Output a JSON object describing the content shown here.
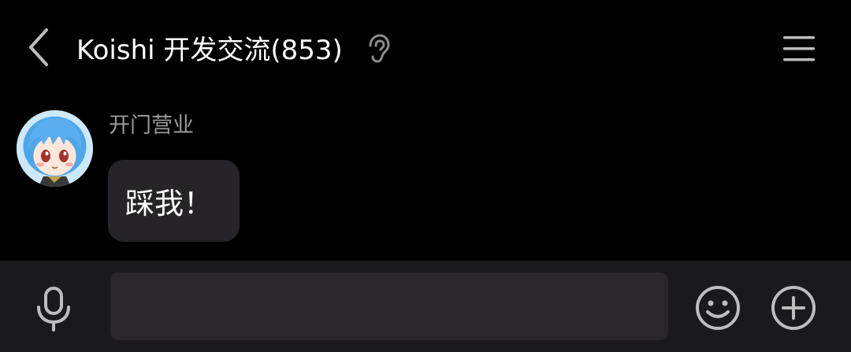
{
  "header": {
    "back_icon": "chevron-left-icon",
    "title": "Koishi 开发交流(853)",
    "ear_icon": "ear-icon",
    "menu_icon": "hamburger-menu-icon"
  },
  "message": {
    "sender_name": "开门营业",
    "text": "踩我！",
    "avatar": "anime-girl-avatar"
  },
  "input_bar": {
    "mic_icon": "microphone-icon",
    "input_value": "",
    "input_placeholder": "",
    "emoji_icon": "smiley-icon",
    "plus_icon": "plus-circle-icon"
  },
  "colors": {
    "background": "#000000",
    "bubble": "#262428",
    "bottom_bar": "#1a191b",
    "input": "#2a272c",
    "icon": "#bdbdbd",
    "sender_text": "#9a9a9a"
  }
}
